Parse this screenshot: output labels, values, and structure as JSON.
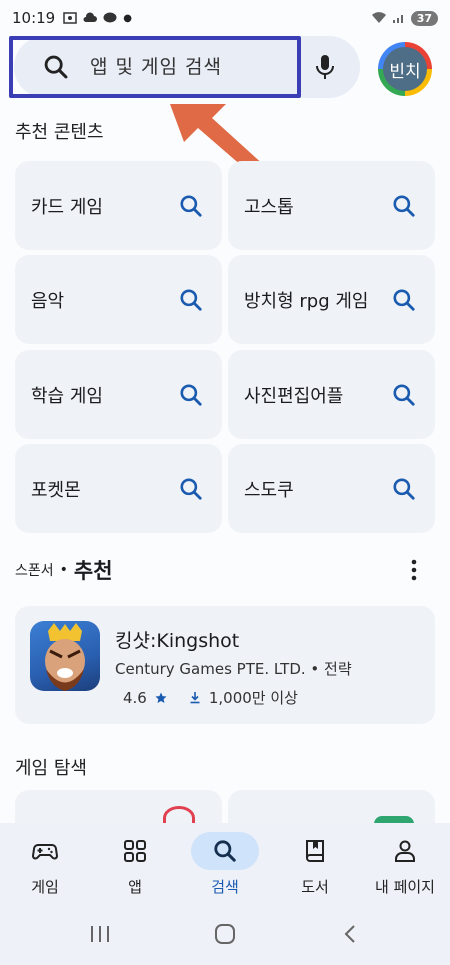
{
  "status": {
    "time": "10:19",
    "battery": "37"
  },
  "search": {
    "placeholder": "앱 및 게임 검색"
  },
  "account": {
    "avatar_text": "빈치"
  },
  "recommended": {
    "title": "추천 콘텐츠",
    "chips": [
      {
        "label": "카드 게임"
      },
      {
        "label": "고스톱"
      },
      {
        "label": "음악"
      },
      {
        "label": "방치형 rpg 게임"
      },
      {
        "label": "학습 게임"
      },
      {
        "label": "사진편집어플"
      },
      {
        "label": "포켓몬"
      },
      {
        "label": "스도쿠"
      }
    ]
  },
  "sponsored": {
    "label": "스폰서",
    "separator": "•",
    "title": "추천",
    "app": {
      "name": "킹샷:Kingshot",
      "publisher": "Century Games PTE. LTD. • 전략",
      "rating": "4.6",
      "downloads": "1,000만 이상"
    }
  },
  "explore": {
    "title": "게임 탐색"
  },
  "nav": {
    "items": [
      {
        "label": "게임",
        "icon": "gamepad-icon"
      },
      {
        "label": "앱",
        "icon": "apps-grid-icon"
      },
      {
        "label": "검색",
        "icon": "search-icon",
        "active": true
      },
      {
        "label": "도서",
        "icon": "book-icon"
      },
      {
        "label": "내 페이지",
        "icon": "person-icon"
      }
    ]
  },
  "colors": {
    "accent": "#1a5bb0",
    "highlight_box": "#3a3db4",
    "arrow": "#e06a45",
    "chip_bg": "#eff2f7"
  }
}
